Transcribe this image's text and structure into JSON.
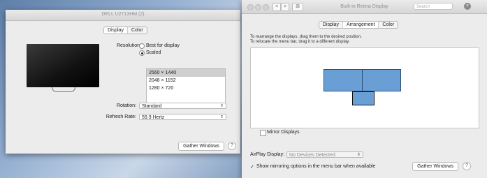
{
  "left_window": {
    "title": "DELL U2713HM (2)",
    "tabs": [
      {
        "label": "Display"
      },
      {
        "label": "Color"
      }
    ],
    "resolution_label": "Resolution:",
    "resolution_options": [
      {
        "label": "Best for display",
        "selected": false
      },
      {
        "label": "Scaled",
        "selected": true
      }
    ],
    "resolutions": [
      "2560 × 1440",
      "2048 × 1152",
      "1280 × 720"
    ],
    "selected_resolution": "2560 × 1440",
    "rotation_label": "Rotation:",
    "rotation_value": "Standard",
    "refresh_label": "Refresh Rate:",
    "refresh_value": "59.9 Hertz",
    "gather_button": "Gather Windows",
    "help": "?"
  },
  "right_window": {
    "title": "Built-in Retina Display",
    "search_placeholder": "Search",
    "nav_back": "<",
    "nav_forward": ">",
    "grid_icon": "⊞",
    "close_glyph": "×",
    "tabs": [
      {
        "label": "Display"
      },
      {
        "label": "Arrangement"
      },
      {
        "label": "Color"
      }
    ],
    "active_tab": "Arrangement",
    "instructions": [
      "To rearrange the displays, drag them to the desired position.",
      "To relocate the menu bar, drag it to a different display."
    ],
    "mirror_label": "Mirror Displays",
    "mirror_checked": false,
    "airplay_label": "AirPlay Display:",
    "airplay_value": "No Devices Detected",
    "show_mirroring_label": "Show mirroring options in the menu bar when available",
    "show_mirroring_checked": true,
    "gather_button": "Gather Windows",
    "help": "?"
  },
  "icons": {
    "popup_arrows": "⇕",
    "checkmark": "✓"
  },
  "colors": {
    "display_blue": "#6a9fd6",
    "display_border": "#2d4e73",
    "window_bg": "#ececec"
  }
}
